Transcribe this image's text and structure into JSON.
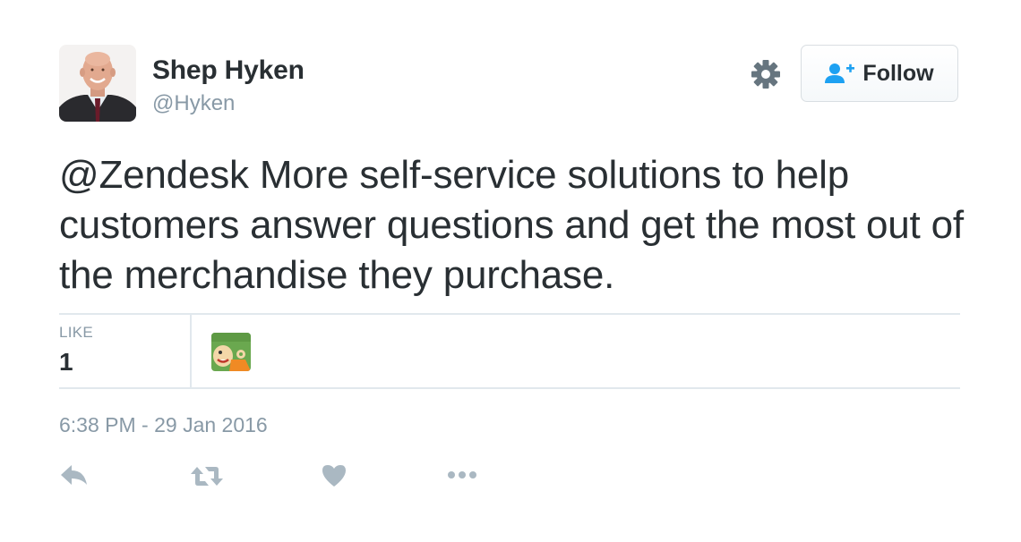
{
  "author": {
    "name": "Shep Hyken",
    "handle": "@Hyken"
  },
  "header": {
    "settings_icon": "gear-icon",
    "follow_icon": "follow-user-plus-icon",
    "follow_label": "Follow"
  },
  "tweet": {
    "mention": "@Zendesk",
    "text": " More self-service solutions to help customers answer questions and get the most out of the merchandise they purchase."
  },
  "stats": {
    "like_label": "LIKE",
    "like_count": "1"
  },
  "timestamp": "6:38 PM - 29 Jan 2016",
  "actions": [
    "reply-icon",
    "retweet-icon",
    "heart-icon",
    "more-icon"
  ],
  "colors": {
    "text": "#292f33",
    "muted": "#8899a6",
    "accent": "#1da1f2",
    "divider": "#e1e8ed"
  }
}
